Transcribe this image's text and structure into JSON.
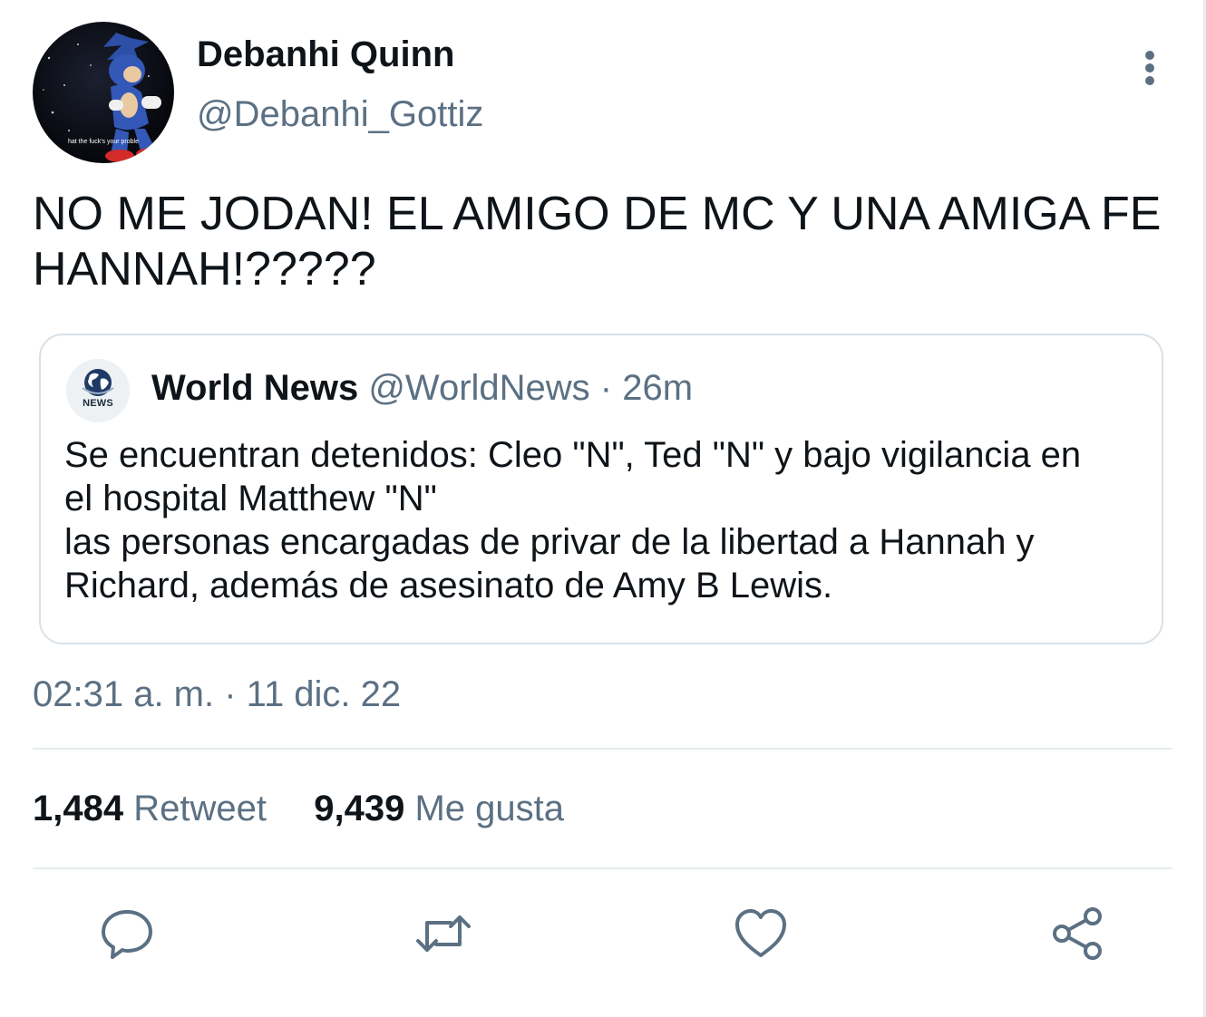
{
  "tweet": {
    "author": {
      "name": "Debanhi Quinn",
      "handle": "@Debanhi_Gottiz",
      "avatar_caption": "hat the fuck's your proble"
    },
    "text": "NO ME JODAN! EL AMIGO DE MC Y UNA AMIGA FE HANNAH!?????",
    "quoted": {
      "avatar_label": "NEWS",
      "name": "World News",
      "handle": "@WorldNews",
      "time": "· 26m",
      "lines": [
        "Se encuentran detenidos: Cleo \"N\", Ted \"N\" y bajo vigilancia en",
        "el hospital Matthew \"N\"",
        "las personas encargadas de privar de la libertad a Hannah y",
        "Richard, además de asesinato de Amy B Lewis."
      ]
    },
    "timestamp": "02:31 a. m. · 11 dic. 22",
    "stats": {
      "retweets_count": "1,484",
      "retweets_label": "Retweet",
      "likes_count": "9,439",
      "likes_label": "Me gusta"
    }
  },
  "icons": {
    "more": "more-vertical-icon",
    "reply": "reply-icon",
    "retweet": "retweet-icon",
    "like": "heart-icon",
    "share": "share-icon",
    "globe": "globe-icon"
  },
  "colors": {
    "text_primary": "#0f1419",
    "text_secondary": "#5b7083",
    "border": "#d8e1e8",
    "divider": "#e6ecf0"
  }
}
